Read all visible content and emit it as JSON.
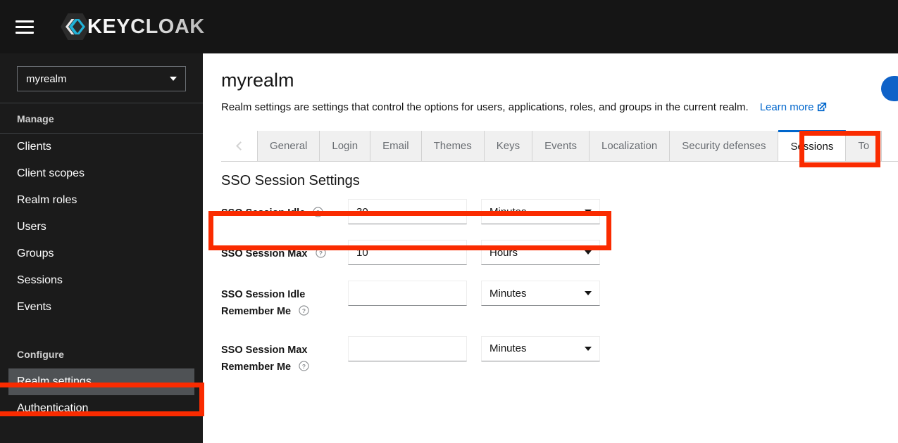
{
  "masthead": {
    "menu_icon": "hamburger-icon",
    "brand_name": "KEYCLOAK",
    "logo_icon": "keycloak-logo-icon",
    "logo_color": "#21b2d8"
  },
  "sidebar": {
    "realm_selector": {
      "value": "myrealm",
      "caret_icon": "chevron-down-icon"
    },
    "sections": [
      {
        "title": "Manage",
        "items": [
          {
            "label": "Clients",
            "active": false
          },
          {
            "label": "Client scopes",
            "active": false
          },
          {
            "label": "Realm roles",
            "active": false
          },
          {
            "label": "Users",
            "active": false
          },
          {
            "label": "Groups",
            "active": false
          },
          {
            "label": "Sessions",
            "active": false
          },
          {
            "label": "Events",
            "active": false
          }
        ]
      },
      {
        "title": "Configure",
        "items": [
          {
            "label": "Realm settings",
            "active": true
          },
          {
            "label": "Authentication",
            "active": false
          }
        ]
      }
    ]
  },
  "main": {
    "title": "myrealm",
    "description": "Realm settings are settings that control the options for users, applications, roles, and groups in the current realm.",
    "learn_more_label": "Learn more",
    "learn_more_icon": "external-link-icon",
    "tabs": {
      "scroll_left_icon": "chevron-left-icon",
      "items": [
        {
          "label": "General",
          "active": false
        },
        {
          "label": "Login",
          "active": false
        },
        {
          "label": "Email",
          "active": false
        },
        {
          "label": "Themes",
          "active": false
        },
        {
          "label": "Keys",
          "active": false
        },
        {
          "label": "Events",
          "active": false
        },
        {
          "label": "Localization",
          "active": false
        },
        {
          "label": "Security defenses",
          "active": false
        },
        {
          "label": "Sessions",
          "active": true
        },
        {
          "label": "To",
          "active": false
        }
      ]
    },
    "section_title": "SSO Session Settings",
    "form_rows": [
      {
        "label": "SSO Session Idle",
        "help_icon": "help-circle-icon",
        "value": "30",
        "placeholder": "",
        "unit": "Minutes",
        "unit_caret_icon": "chevron-down-icon"
      },
      {
        "label": "SSO Session Max",
        "help_icon": "help-circle-icon",
        "value": "10",
        "placeholder": "",
        "unit": "Hours",
        "unit_caret_icon": "chevron-down-icon"
      },
      {
        "label": "SSO Session Idle Remember Me",
        "help_icon": "help-circle-icon",
        "value": "",
        "placeholder": "",
        "unit": "Minutes",
        "unit_caret_icon": "chevron-down-icon"
      },
      {
        "label": "SSO Session Max Remember Me",
        "help_icon": "help-circle-icon",
        "value": "",
        "placeholder": "",
        "unit": "Minutes",
        "unit_caret_icon": "chevron-down-icon"
      }
    ]
  },
  "annotations": {
    "color": "#fa2b00",
    "targets": [
      "sessions-tab",
      "sso-session-idle-row",
      "realm-settings-nav-item"
    ]
  },
  "colors": {
    "masthead_bg": "#151515",
    "sidebar_bg": "#1b1b1b",
    "nav_active_bg": "#4f5255",
    "accent_blue": "#0066cc",
    "annotation_red": "#fa2b00"
  }
}
